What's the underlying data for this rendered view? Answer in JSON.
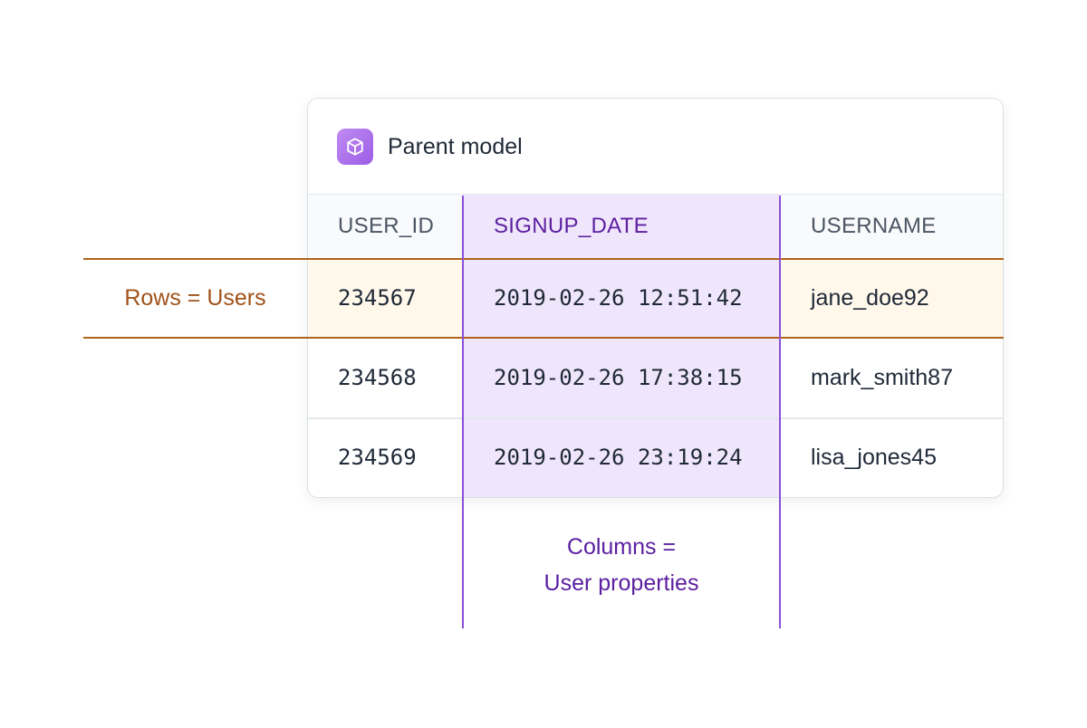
{
  "card": {
    "title": "Parent model",
    "icon": "cube-icon",
    "accent": "#9b5de5"
  },
  "table": {
    "columns": [
      "USER_ID",
      "SIGNUP_DATE",
      "USERNAME"
    ],
    "rows": [
      [
        "234567",
        "2019-02-26 12:51:42",
        "jane_doe92"
      ],
      [
        "234568",
        "2019-02-26 17:38:15",
        "mark_smith87"
      ],
      [
        "234569",
        "2019-02-26 23:19:24",
        "lisa_jones45"
      ]
    ],
    "highlighted_column": "SIGNUP_DATE",
    "highlighted_row": "234567"
  },
  "annotations": {
    "rows_label": "Rows = Users",
    "rows_color": "#a0521a",
    "columns_label_line1": "Columns =",
    "columns_label_line2": "User properties",
    "columns_color": "#5b1fa0"
  }
}
